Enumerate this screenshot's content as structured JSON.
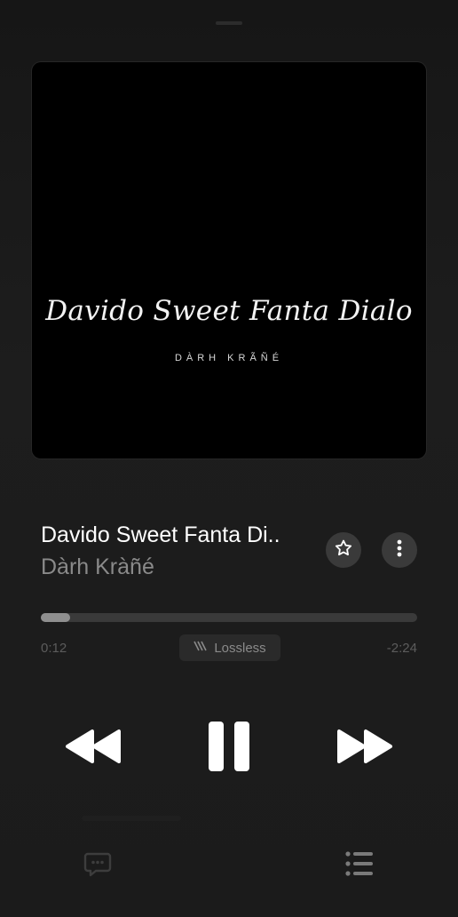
{
  "artwork": {
    "title": "Davido Sweet Fanta Dialo",
    "artist": "DÀRH KRÃÑÉ"
  },
  "track": {
    "title": "Davido Sweet Fanta Di..",
    "artist": "Dàrh Kràñé"
  },
  "progress": {
    "fraction": 0.077,
    "elapsed": "0:12",
    "remaining": "-2:24"
  },
  "quality_badge": "Lossless",
  "icons": {
    "favorite": "star-icon",
    "more": "more-vertical-icon",
    "rewind": "backward-icon",
    "pause": "pause-icon",
    "forward": "forward-icon",
    "lyrics": "lyrics-bubble-icon",
    "queue": "queue-list-icon"
  },
  "colors": {
    "background": "#1c1c1c",
    "accent": "#ffffff",
    "secondary_text": "#8a8a8a"
  }
}
